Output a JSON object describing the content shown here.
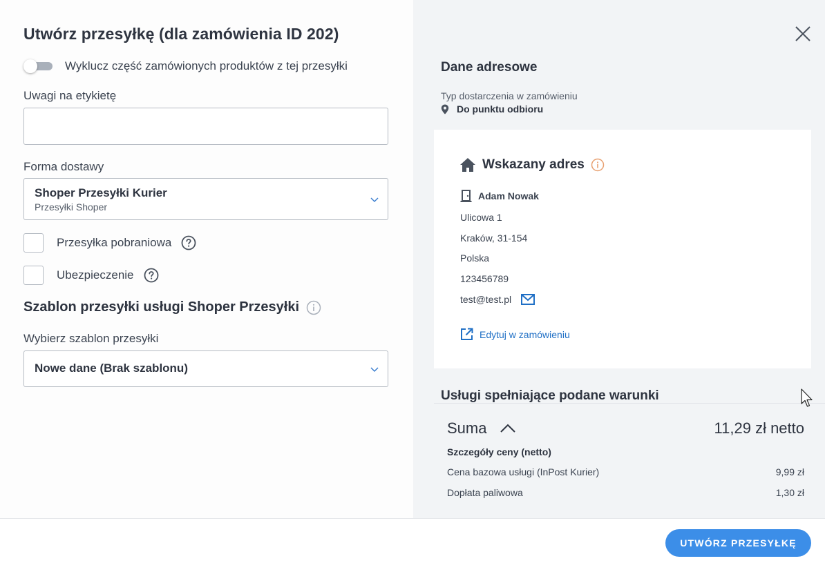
{
  "form": {
    "title": "Utwórz przesyłkę (dla zamówienia ID 202)",
    "exclude_toggle_label": "Wyklucz część zamówionych produktów z tej przesyłki",
    "label_notes_label": "Uwagi na etykietę",
    "label_notes_value": "",
    "delivery_form_label": "Forma dostawy",
    "delivery_selected_main": "Shoper Przesyłki Kurier",
    "delivery_selected_sub": "Przesyłki Shoper",
    "cod_label": "Przesyłka pobraniowa",
    "insurance_label": "Ubezpieczenie",
    "template_section_title": "Szablon przesyłki usługi Shoper Przesyłki",
    "template_select_label": "Wybierz szablon przesyłki",
    "template_selected": "Nowe dane (Brak szablonu)"
  },
  "address": {
    "section_title": "Dane adresowe",
    "delivery_type_label": "Typ dostarczenia w zamówieniu",
    "delivery_type_value": "Do punktu odbioru",
    "card_title": "Wskazany adres",
    "name": "Adam Nowak",
    "street": "Ulicowa 1",
    "city": "Kraków, 31-154",
    "country": "Polska",
    "phone": "123456789",
    "email": "test@test.pl",
    "edit_link": "Edytuj w zamówieniu"
  },
  "services": {
    "section_title": "Usługi spełniające podane warunki"
  },
  "summary": {
    "label": "Suma",
    "total": "11,29 zł netto",
    "details_title": "Szczegóły ceny (netto)",
    "rows": [
      {
        "label": "Cena bazowa usługi (InPost Kurier)",
        "value": "9,99 zł"
      },
      {
        "label": "Dopłata paliwowa",
        "value": "1,30 zł"
      }
    ]
  },
  "footer": {
    "create_button": "UTWÓRZ PRZESYŁKĘ"
  },
  "colors": {
    "accent": "#3c8ee8",
    "link": "#1f6fc5",
    "info_orange": "#e8a070",
    "panel_bg": "#f2f4f6"
  }
}
